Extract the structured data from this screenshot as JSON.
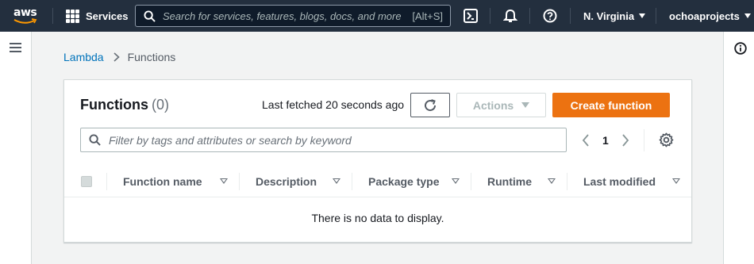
{
  "topnav": {
    "logo_text": "aws",
    "services_label": "Services",
    "search_placeholder": "Search for services, features, blogs, docs, and more",
    "search_shortcut": "[Alt+S]",
    "region": "N. Virginia",
    "account": "ochoaprojects",
    "icons": [
      "cloudshell-icon",
      "bell-icon",
      "help-icon"
    ]
  },
  "breadcrumb": {
    "parent": "Lambda",
    "current": "Functions"
  },
  "functions": {
    "title": "Functions",
    "count": "(0)",
    "last_fetched": "Last fetched 20 seconds ago",
    "actions_label": "Actions",
    "create_label": "Create function",
    "filter_placeholder": "Filter by tags and attributes or search by keyword",
    "page": "1",
    "columns": [
      "Function name",
      "Description",
      "Package type",
      "Runtime",
      "Last modified"
    ],
    "empty_message": "There is no data to display."
  },
  "colors": {
    "nav_bg": "#232f3e",
    "primary_button": "#ec7211",
    "link": "#0073bb"
  }
}
